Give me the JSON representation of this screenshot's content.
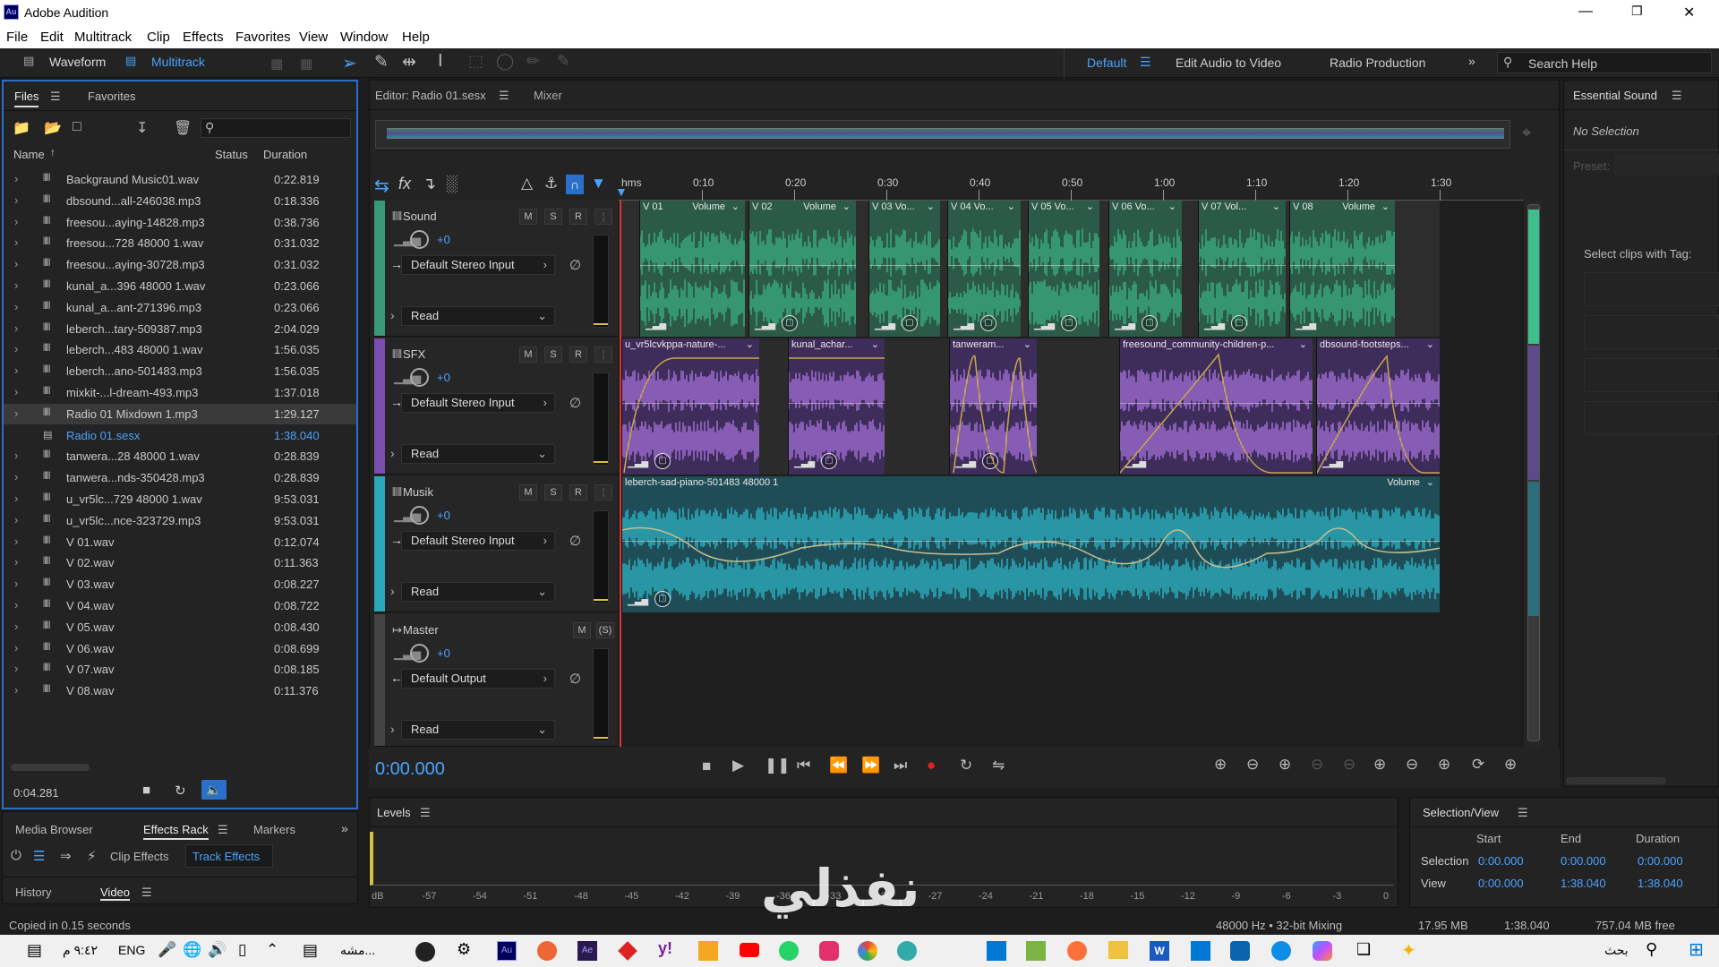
{
  "window": {
    "title": "Adobe Audition",
    "logo": "Au"
  },
  "menu": [
    "File",
    "Edit",
    "Multitrack",
    "Clip",
    "Effects",
    "Favorites",
    "View",
    "Window",
    "Help"
  ],
  "toolbar": {
    "tabs": [
      "Waveform",
      "Multitrack"
    ],
    "workspaces": [
      "Default",
      "Edit Audio to Video",
      "Radio Production"
    ],
    "search_placeholder": "Search Help"
  },
  "files_panel": {
    "tabs": [
      "Files",
      "Favorites"
    ],
    "columns": [
      "Name",
      "Status",
      "Duration"
    ],
    "rows": [
      {
        "name": "Backgraund Music01.wav",
        "dur": "0:22.819"
      },
      {
        "name": "dbsound...all-246038.mp3",
        "dur": "0:18.336"
      },
      {
        "name": "freesou...aying-14828.mp3",
        "dur": "0:38.736"
      },
      {
        "name": "freesou...728 48000 1.wav",
        "dur": "0:31.032"
      },
      {
        "name": "freesou...aying-30728.mp3",
        "dur": "0:31.032"
      },
      {
        "name": "kunal_a...396 48000 1.wav",
        "dur": "0:23.066"
      },
      {
        "name": "kunal_a...ant-271396.mp3",
        "dur": "0:23.066"
      },
      {
        "name": "leberch...tary-509387.mp3",
        "dur": "2:04.029"
      },
      {
        "name": "leberch...483 48000 1.wav",
        "dur": "1:56.035"
      },
      {
        "name": "leberch...ano-501483.mp3",
        "dur": "1:56.035"
      },
      {
        "name": "mixkit-...l-dream-493.mp3",
        "dur": "1:37.018"
      },
      {
        "name": "Radio 01 Mixdown 1.mp3",
        "dur": "1:29.127"
      },
      {
        "name": "Radio 01.sesx",
        "dur": "1:38.040"
      },
      {
        "name": "tanwera...28 48000 1.wav",
        "dur": "0:28.839"
      },
      {
        "name": "tanwera...nds-350428.mp3",
        "dur": "0:28.839"
      },
      {
        "name": "u_vr5lc...729 48000 1.wav",
        "dur": "9:53.031"
      },
      {
        "name": "u_vr5lc...nce-323729.mp3",
        "dur": "9:53.031"
      },
      {
        "name": "V 01.wav",
        "dur": "0:12.074"
      },
      {
        "name": "V 02.wav",
        "dur": "0:11.363"
      },
      {
        "name": "V 03.wav",
        "dur": "0:08.227"
      },
      {
        "name": "V 04.wav",
        "dur": "0:08.722"
      },
      {
        "name": "V 05.wav",
        "dur": "0:08.430"
      },
      {
        "name": "V 06.wav",
        "dur": "0:08.699"
      },
      {
        "name": "V 07.wav",
        "dur": "0:08.185"
      },
      {
        "name": "V 08.wav",
        "dur": "0:11.376"
      }
    ],
    "footer_time": "0:04.281"
  },
  "editor": {
    "tabs": [
      "Editor: Radio 01.sesx",
      "Mixer"
    ],
    "ruler": [
      "hms",
      "0:10",
      "0:20",
      "0:30",
      "0:40",
      "0:50",
      "1:00",
      "1:10",
      "1:20",
      "1:30"
    ],
    "tracks": [
      {
        "name": "Sound",
        "vol": "+0",
        "input": "Default Stereo Input",
        "mode": "Read",
        "buttons": [
          "M",
          "S",
          "R"
        ],
        "color": "#3a9a78"
      },
      {
        "name": "SFX",
        "vol": "+0",
        "input": "Default Stereo Input",
        "mode": "Read",
        "buttons": [
          "M",
          "S",
          "R"
        ],
        "color": "#7a4fb0"
      },
      {
        "name": "Musik",
        "vol": "+0",
        "input": "Default Stereo Input",
        "mode": "Read",
        "buttons": [
          "M",
          "S",
          "R"
        ],
        "color": "#2aa8b8"
      },
      {
        "name": "Master",
        "vol": "+0",
        "input": "Default Output",
        "mode": "Read",
        "buttons": [
          "M",
          "(S)"
        ],
        "color": "#444"
      }
    ],
    "sound_clips": [
      "V 01",
      "V 02",
      "V 03 Vo...",
      "V 04 Vo...",
      "V 05 Vo...",
      "V 06 Vo...",
      "V 07 Vol...",
      "V 08"
    ],
    "volume_label": "Volume",
    "sfx_clips": [
      "u_vr5lcvkppa-nature-...",
      "kunal_achar...",
      "tanweram...",
      "freesound_community-children-p...",
      "dbsound-footsteps..."
    ],
    "musik_clip": "leberch-sad-piano-501483 48000 1",
    "timecode": "0:00.000"
  },
  "essential_sound": {
    "title": "Essential Sound",
    "no_selection": "No Selection",
    "preset_label": "Preset:",
    "tag_label": "Select clips with Tag:"
  },
  "bottom": {
    "left_tabs": [
      "Media Browser",
      "Effects Rack",
      "Markers"
    ],
    "subtabs": [
      "Clip Effects",
      "Track Effects"
    ],
    "history_tabs": [
      "History",
      "Video"
    ],
    "levels_title": "Levels",
    "levels_scale": [
      "dB",
      "-57",
      "-54",
      "-51",
      "-48",
      "-45",
      "-42",
      "-39",
      "-36",
      "-33",
      "-30",
      "-27",
      "-24",
      "-21",
      "-18",
      "-15",
      "-12",
      "-9",
      "-6",
      "-3",
      "0"
    ],
    "selview": {
      "title": "Selection/View",
      "headers": [
        "Start",
        "End",
        "Duration"
      ],
      "selection": {
        "label": "Selection",
        "start": "0:00.000",
        "end": "0:00.000",
        "dur": "0:00.000"
      },
      "view": {
        "label": "View",
        "start": "0:00.000",
        "end": "1:38.040",
        "dur": "1:38.040"
      }
    }
  },
  "status": {
    "left": "Copied in 0.15 seconds",
    "rate": "48000 Hz • 32-bit Mixing",
    "mem": "17.95 MB",
    "len": "1:38.040",
    "free": "757.04 MB free"
  },
  "watermark": "نفذلي",
  "taskbar": {
    "time": "٩:٤٢ م",
    "lang": "ENG",
    "search": "بحث",
    "app_label": "مشه..."
  }
}
